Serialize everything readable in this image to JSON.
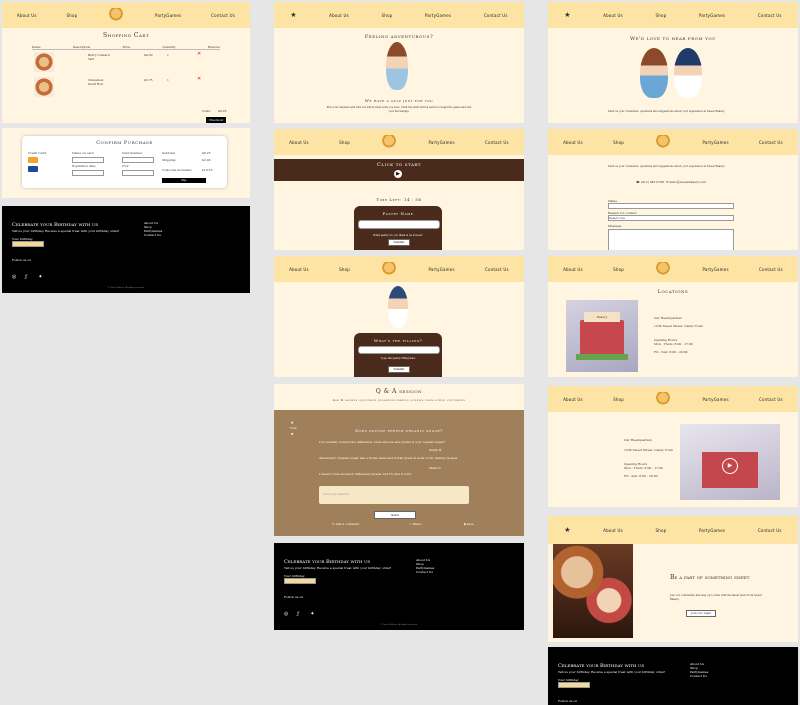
{
  "nav": {
    "about": "About Us",
    "shop": "Shop",
    "partygames": "PartyGames",
    "contact": "Contact Us",
    "brand": "Sweet Bakery"
  },
  "cart": {
    "title": "Shopping Cart",
    "headers": [
      "Items",
      "Description",
      "Price",
      "Quantity",
      "Remove"
    ],
    "rows": [
      {
        "desc": "Berry Custard Tart",
        "price": "$4.50",
        "qty": "1"
      },
      {
        "desc": "Cinnamon Swirl Roll",
        "price": "$3.75",
        "qty": "1"
      }
    ],
    "total_label": "Total:",
    "total_value": "$8.25",
    "checkout": "Checkout"
  },
  "purchase": {
    "title": "Confirm Purchase",
    "card_label": "Credit Card",
    "name_label": "Name on card",
    "number_label": "Card number",
    "date_label": "Expiration date",
    "cvv_label": "CVV",
    "subtotal_label": "Subtotal",
    "shipping_label": "Shipping",
    "total_label": "Total (tax included)",
    "subtotal": "$8.25",
    "shipping": "$2.00",
    "total": "$10.25",
    "pay": "Pay"
  },
  "footer": {
    "heading": "Celebrate your Birthday with us",
    "sub": "Tell us your birthday. Receive a special treat with your birthday order!",
    "date_label": "Your birthday",
    "follow": "Follow us on",
    "links": [
      "About Us",
      "Shop",
      "PartyGames",
      "Contact Us"
    ],
    "copyright": "© Sweet Bakery. All rights reserved."
  },
  "game": {
    "title": "Feeling adventurous?",
    "sub": "We have a quiz just for you",
    "desc": "Pick your answers and find out which treat suits you best. Click the start button below to begin the game and test your knowledge.",
    "click_start": "Click to start",
    "time_label": "Time Left:",
    "time": "14 : 56",
    "question1": "Pastry Name",
    "q1_hint": "What pastry do you think is on screen?",
    "submit": "Submit",
    "question2": "What's the filling?",
    "q2_hint": "Type the pastry filling here",
    "submit2": "Submit"
  },
  "qa": {
    "title": "Q & A session",
    "sub": "Ask & answer questions regarding baking queries from other customers",
    "upvote": "Vote",
    "post_title": "Does anyone prefer organic sugar?",
    "post_text": "I've recently noticed the difference. Does anyone else prefer it over regular sugar?",
    "reply_name": "Sarah B.",
    "reply_text": "Absolutely! Organic sugar has a richer taste and works great in most of my baking recipes.",
    "reply2_name": "Mark D.",
    "reply2_text": "I haven't noticed much difference myself, but I'll give it a try.",
    "placeholder": "Add your answer...",
    "send": "Send",
    "comment": "Add a comment",
    "share": "Share",
    "save": "Save"
  },
  "contact": {
    "title": "We'd love to hear from you",
    "desc": "Send us your comments, questions and suggestions about your experience at Sweet Bakery.",
    "phone": "(012) 345 6789",
    "email": "hello@sweetbakery.com",
    "name_label": "Name",
    "reason_label": "Reason for contact",
    "reason_value": "Select one",
    "message_label": "Message",
    "locations": "Locations",
    "address_title": "Our Headquarters",
    "address": "1234 Sweet Street, Candy Town",
    "hours_title": "Opening Hours",
    "hours": "Mon - Thurs: 8:00 - 17:00",
    "hours2": "Fri - Sun: 8:00 - 20:00",
    "store_sign": "Bakery",
    "join_title": "Be a part of something sweet",
    "join_text": "Join our community and stay up to date with the latest news from Sweet Bakery.",
    "join_btn": "Join our team"
  },
  "colors": {
    "nav": "#fde4a5",
    "cream": "#fff5e1",
    "brown": "#4a2a1a",
    "qa": "#a0805a"
  }
}
